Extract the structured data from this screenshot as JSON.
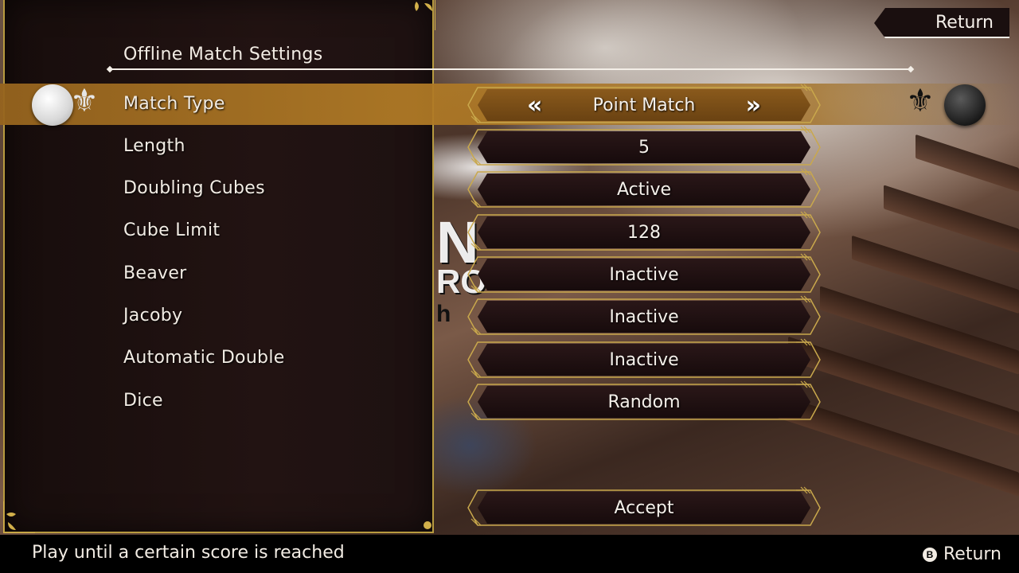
{
  "screen": {
    "title": "Offline Match Settings",
    "return_label": "Return"
  },
  "settings": [
    {
      "label": "Match Type",
      "value": "Point Match",
      "selected": true
    },
    {
      "label": "Length",
      "value": "5"
    },
    {
      "label": "Doubling Cubes",
      "value": "Active"
    },
    {
      "label": "Cube Limit",
      "value": "128"
    },
    {
      "label": "Beaver",
      "value": "Inactive"
    },
    {
      "label": "Jacoby",
      "value": "Inactive"
    },
    {
      "label": "Automatic Double",
      "value": "Inactive"
    },
    {
      "label": "Dice",
      "value": "Random"
    }
  ],
  "selector": {
    "prev_glyph": "«",
    "next_glyph": "»"
  },
  "accept_label": "Accept",
  "footer": {
    "hint": "Play until a certain score is reached",
    "button_glyph": "B",
    "return_label": "Return"
  },
  "icons": {
    "left_marker": "white-checker-icon",
    "right_marker": "black-checker-icon",
    "ornament": "fleur-de-lis-icon"
  },
  "colors": {
    "gold_trim": "#c9a84c",
    "highlight": "#b07a26",
    "panel": "#1d1111"
  }
}
